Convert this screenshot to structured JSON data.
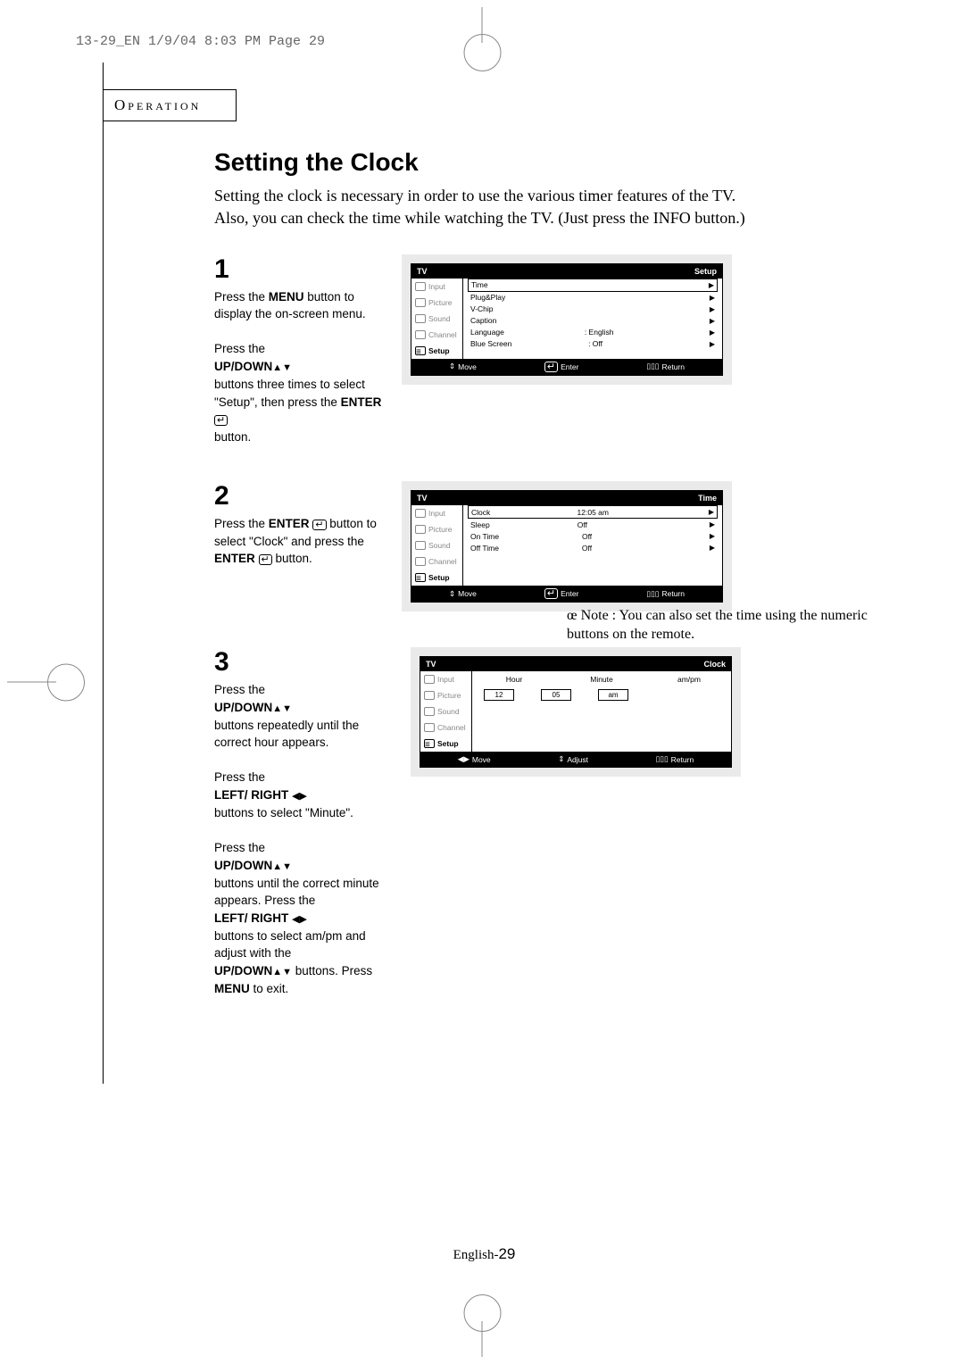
{
  "header_tag": "13-29_EN  1/9/04 8:03 PM  Page 29",
  "section_label": "Operation",
  "title": "Setting the Clock",
  "intro_line1": "Setting the clock is  necessary in order to use the various timer features of the TV.",
  "intro_line2": "Also, you can check the time while watching the TV. (Just press the INFO button.)",
  "steps": {
    "s1": {
      "num": "1",
      "p1a": "Press the ",
      "p1b": "MENU",
      "p1c": " button to display the on-screen menu.",
      "p2a": "Press the ",
      "p2b": "UP/DOWN",
      "p2c": " buttons three times to select \"Setup\", then press the ",
      "p2d": "ENTER",
      "p2e": " button."
    },
    "s2": {
      "num": "2",
      "p1a": "Press the ",
      "p1b": "ENTER",
      "p1c": " button to select \"Clock\" and press the ",
      "p1d": "ENTER",
      "p1e": " button."
    },
    "s3": {
      "num": "3",
      "p1a": "Press the ",
      "p1b": "UP/DOWN",
      "p1c": " buttons repeatedly until the correct hour appears.",
      "p2a": "Press the ",
      "p2b": "LEFT/ RIGHT",
      "p2c": " buttons to select \"Minute\".",
      "p3a": "Press the ",
      "p3b": "UP/DOWN",
      "p3c": " buttons until the correct minute appears. Press the ",
      "p3d": "LEFT/ RIGHT",
      "p3e": " buttons to select am/pm and adjust with the ",
      "p3f": "UP/DOWN",
      "p3g": " buttons. Press ",
      "p3h": "MENU",
      "p3i": " to exit."
    }
  },
  "note_marker": "œ",
  "note_label": "Note : ",
  "note_text": "You can also set the time using the numeric buttons on the remote.",
  "footer_lang": "English-",
  "footer_num": "29",
  "osd": {
    "tv": "TV",
    "side": {
      "input": "Input",
      "picture": "Picture",
      "sound": "Sound",
      "channel": "Channel",
      "setup": "Setup"
    },
    "foot": {
      "move": "Move",
      "enter": "Enter",
      "return": "Return",
      "adjust": "Adjust"
    }
  },
  "osd1": {
    "head_right": "Setup",
    "rows": [
      {
        "k": "Time",
        "v": "",
        "sel": true
      },
      {
        "k": "Plug&Play",
        "v": ""
      },
      {
        "k": "V-Chip",
        "v": ""
      },
      {
        "k": "Caption",
        "v": ""
      },
      {
        "k": "Language",
        "v": ":   English"
      },
      {
        "k": "Blue Screen",
        "v": ":   Off"
      }
    ]
  },
  "osd2": {
    "head_right": "Time",
    "rows": [
      {
        "k": "Clock",
        "v": "12:05 am",
        "sel": true
      },
      {
        "k": "Sleep",
        "v": "Off"
      },
      {
        "k": "On Time",
        "v": "Off"
      },
      {
        "k": "Off Time",
        "v": "Off"
      }
    ]
  },
  "osd3": {
    "head_right": "Clock",
    "cols": {
      "hour": "Hour",
      "minute": "Minute",
      "ampm": "am/pm"
    },
    "vals": {
      "hour": "12",
      "minute": "05",
      "ampm": "am"
    }
  }
}
